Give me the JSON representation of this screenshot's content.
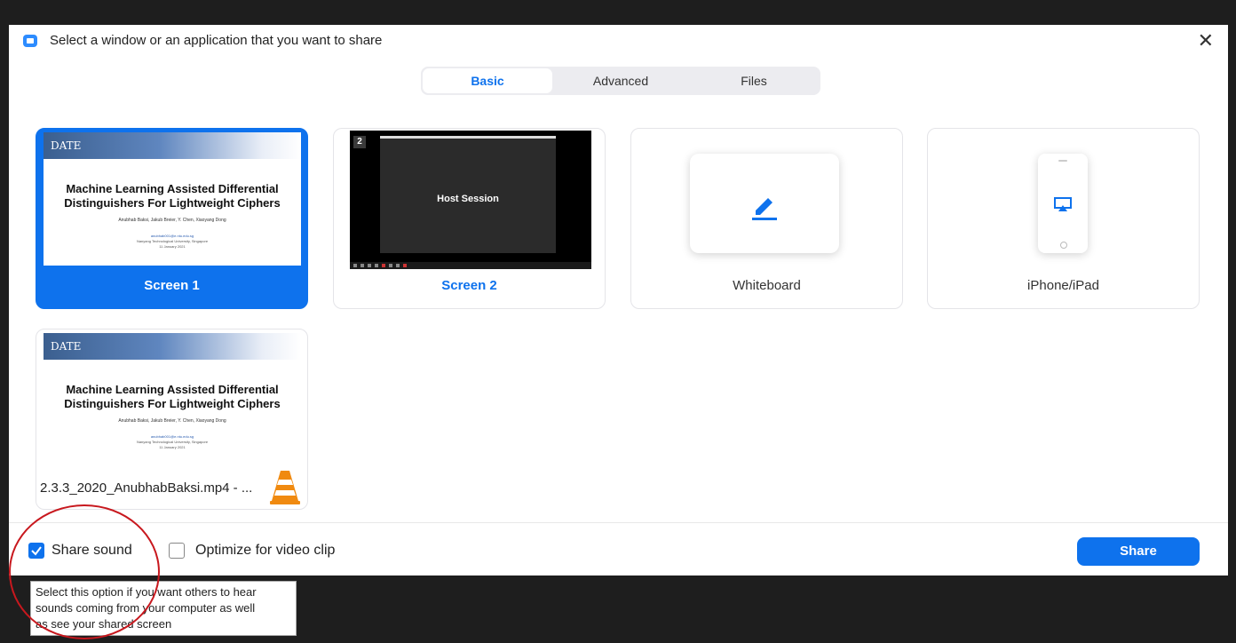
{
  "dialog": {
    "title": "Select a window or an application that you want to share",
    "close": "✕"
  },
  "tabs": [
    {
      "label": "Basic",
      "active": true
    },
    {
      "label": "Advanced",
      "active": false
    },
    {
      "label": "Files",
      "active": false
    }
  ],
  "slide": {
    "logo": "DATE",
    "title_line1": "Machine Learning Assisted Differential",
    "title_line2": "Distinguishers For Lightweight Ciphers",
    "authors": "Anubhab Baksi, Jakub Breier, Y. Chen, Xiaoyang Dong",
    "email": "anubhab001@e.ntu.edu.sg",
    "affiliation": "Nanyang Technological University, Singapore",
    "date": "11 January 2021"
  },
  "tiles": {
    "screen1": {
      "label": "Screen 1",
      "selected": true
    },
    "screen2": {
      "label": "Screen 2",
      "number": "2",
      "preview_text": "Host Session"
    },
    "whiteboard": {
      "label": "Whiteboard",
      "icon": "pen-icon"
    },
    "iphone": {
      "label": "iPhone/iPad",
      "icon": "airplay-icon"
    },
    "video": {
      "label": "2.3.3_2020_AnubhabBaksi.mp4 - ...",
      "icon": "vlc-icon"
    }
  },
  "footer": {
    "share_sound": {
      "label": "Share sound",
      "checked": true
    },
    "optimize_video": {
      "label": "Optimize for video clip",
      "checked": false
    },
    "share_button": "Share"
  },
  "tooltip": {
    "line1": "Select this option if you want others to hear",
    "line2": "sounds coming from your computer as well",
    "line3": "as see your shared screen"
  },
  "colors": {
    "accent": "#0e72ed",
    "annotation": "#c8181e",
    "background": "#1e1e1e"
  }
}
